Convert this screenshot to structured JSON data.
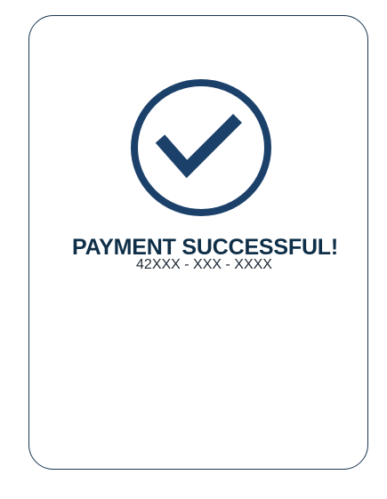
{
  "payment": {
    "status_title": "PAYMENT SUCCESSFUL!",
    "reference_number": "42XXX - XXX - XXXX",
    "status_icon": "check-circle-icon"
  },
  "colors": {
    "accent": "#1b416b",
    "title_text": "#0f2f48",
    "card_border": "#1b3550"
  }
}
